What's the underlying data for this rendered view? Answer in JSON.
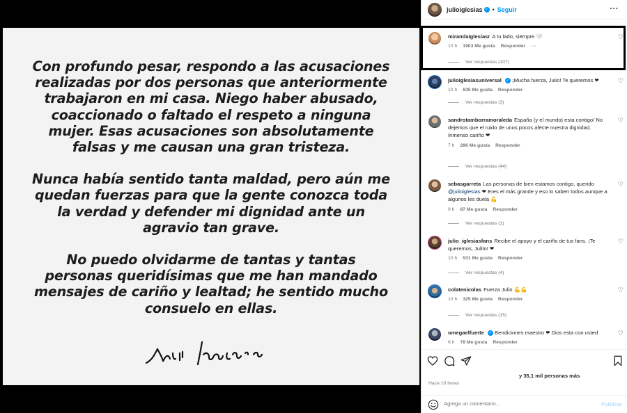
{
  "statement": {
    "paragraphs": [
      "Con profundo pesar, respondo a las acusaciones realizadas por dos personas que anteriormente trabajaron en mi casa. Niego haber abusado, coaccionado o faltado el respeto a ninguna mujer. Esas acusaciones son absolutamente falsas y me causan una gran tristeza.",
      "Nunca había sentido tanta maldad, pero aún me quedan fuerzas para que la gente conozca toda la verdad y defender mi dignidad ante un agravio tan grave.",
      "No puedo olvidarme de tantas y tantas personas queridísimas que me han mandado mensajes de cariño y lealtad; he sentido mucho consuelo en ellas."
    ]
  },
  "header": {
    "username": "julioiglesias",
    "dot": "•",
    "follow": "Seguir",
    "more": "···"
  },
  "comments": [
    {
      "user": "mirandaiglesiasr",
      "text": "A tu lado, siempre 🤍",
      "time": "10 h",
      "likes": "1903 Me gusta",
      "reply": "Responder",
      "dots": "···",
      "replies": "Ver respuestas (107)"
    },
    {
      "user": "julioiglesiasuniversal",
      "text": "¡Mucha fuerza, Julio! Te queremos ❤",
      "time": "10 h",
      "likes": "635 Me gusta",
      "reply": "Responder",
      "replies": "Ver respuestas (3)"
    },
    {
      "user": "sandrotamborramoraleda",
      "text": "España (y el mundo) esta contigo! No dejemos que el ruido de unos pocos afecte nuestra dignidad. Inmenso cariño ❤",
      "time": "7 h",
      "likes": "286 Me gusta",
      "reply": "Responder",
      "replies": "Ver respuestas (44)"
    },
    {
      "user": "sebasgarreta",
      "text_pre": "Las personas de bien estamos contigo, querido ",
      "mention": "@julioiglesias",
      "text_post": " ❤ Eres el más grande y eso lo saben todos aunque a algunos les duela 💪",
      "time": "9 h",
      "likes": "87 Me gusta",
      "reply": "Responder",
      "replies": "Ver respuestas (1)"
    },
    {
      "user": "julio_iglesiasfans",
      "text": "Recibe el apoyo y el cariño de tus fans. ¡Te queremos, Julito! ❤",
      "time": "10 h",
      "likes": "531 Me gusta",
      "reply": "Responder",
      "replies": "Ver respuestas (4)"
    },
    {
      "user": "colatenicolas",
      "text": "Fuerza Julio 💪💪",
      "time": "10 h",
      "likes": "325 Me gusta",
      "reply": "Responder",
      "replies": "Ver respuestas (15)"
    },
    {
      "user": "omegaelfuerte",
      "text": "Bendiciones maestro ❤ Dios esta con usted",
      "time": "6 h",
      "likes": "78 Me gusta",
      "reply": "Responder"
    }
  ],
  "likes_summary": "y 35,1 mil personas más",
  "time_ago": "Hace 10 horas",
  "add_comment": {
    "placeholder": "Agrega un comentario...",
    "publish": "Publicar"
  }
}
